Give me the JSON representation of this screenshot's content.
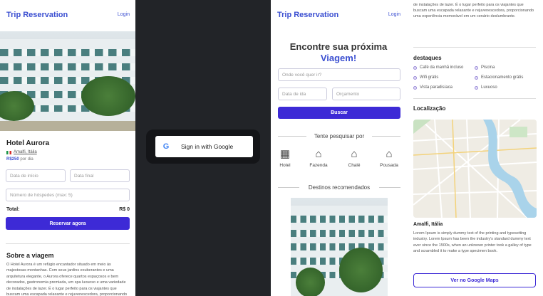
{
  "header": {
    "brand": "Trip Reservation",
    "login": "Login"
  },
  "hotel": {
    "name": "Hotel Aurora",
    "location": "Amalfi, Itália",
    "price": "R$250",
    "price_unit": "por dia"
  },
  "booking": {
    "start_placeholder": "Data de início",
    "end_placeholder": "Data final",
    "guests_placeholder": "Número de hóspedes (max: 5)",
    "total_label": "Total:",
    "total_value": "R$ 0",
    "reserve_button": "Reservar agora"
  },
  "about": {
    "title": "Sobre a viagem",
    "text": "O Hotel Aurora é um refúgio encantador situado em meio às majestosas montanhas. Com seus jardins exuberantes e uma arquitetura elegante, o Aurora oferece quartos espaçosos e bem decorados, gastronomia premiada, um spa luxuoso e uma variedade de instalações de lazer. É o lugar perfeito para os viajantes que buscam uma escapada relaxante e rejuvenescedora, proporcionando uma experiência memorável em um cenário deslumbrante."
  },
  "google": {
    "label": "Sign in with Google"
  },
  "search": {
    "headline": "Encontre sua próxima",
    "headline_accent": "Viagem!",
    "where_placeholder": "Onde você quer ir?",
    "date_placeholder": "Data de ida",
    "budget_placeholder": "Orçamento",
    "search_button": "Buscar",
    "try_label": "Tente pesquisar por",
    "categories": [
      "Hotel",
      "Fazenda",
      "Chalé",
      "Pousada"
    ],
    "recommended_label": "Destinos recomendados"
  },
  "highlights": {
    "title": "destaques",
    "items": [
      "Café da manhã incluso",
      "Piscina",
      "Wifi grátis",
      "Estacionamento grátis",
      "Vista paradisíaca",
      "Luxuoso"
    ]
  },
  "location": {
    "title": "Localização",
    "place": "Amalfi, Itália",
    "text": "Lorem Ipsum is simply dummy text of the printing and typesetting industry. Lorem Ipsum has been the industry's standard dummy text ever since the 1500s, when an unknown printer took a galley of type and scrambled it to make a type specimen book.",
    "maps_button": "Ver no Google Maps"
  },
  "colors": {
    "accent": "#3d2ad6",
    "brand": "#3b4fd1",
    "dark_bg": "#222428"
  }
}
